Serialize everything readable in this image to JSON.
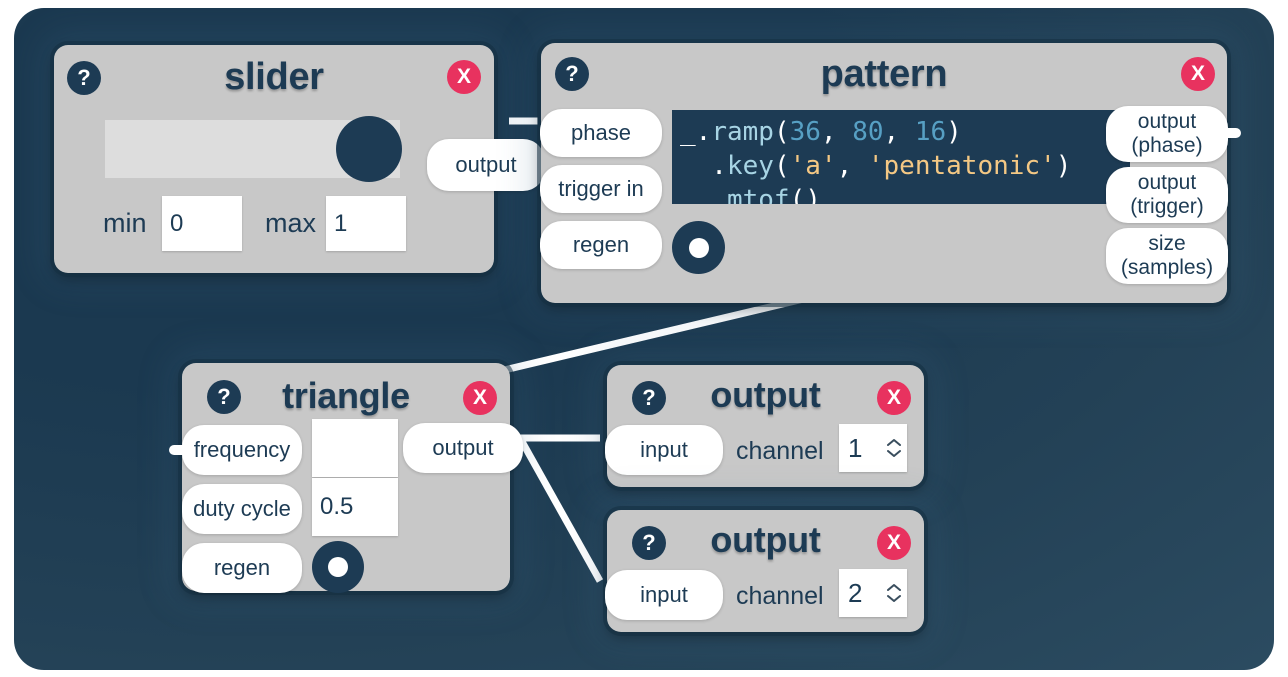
{
  "app": {
    "canvas_name": "node-graph-canvas",
    "background_color": "#1b3950",
    "node_color": "#c8c8c8",
    "accent_color": "#1d3b54",
    "close_color": "#e8325f",
    "wire_color": "#ffffff"
  },
  "icons": {
    "help": "?",
    "close": "X",
    "chevron_up": "▲",
    "chevron_down": "▼"
  },
  "nodes": {
    "slider": {
      "title": "slider",
      "help_label": "?",
      "close_label": "X",
      "slider_value_fraction": 0.87,
      "ports": {
        "output": "output"
      },
      "fields": {
        "min_label": "min",
        "min_value": "0",
        "max_label": "max",
        "max_value": "1"
      }
    },
    "pattern": {
      "title": "pattern",
      "help_label": "?",
      "close_label": "X",
      "inputs": {
        "phase": "phase",
        "trigger_in": "trigger in",
        "regen": "regen"
      },
      "outputs": {
        "output_phase_line1": "output",
        "output_phase_line2": "(phase)",
        "output_trigger_line1": "output",
        "output_trigger_line2": "(trigger)",
        "size_line1": "size",
        "size_line2": "(samples)"
      },
      "code": {
        "line1": [
          {
            "t": "_.",
            "c": "pun"
          },
          {
            "t": "ramp",
            "c": "fn"
          },
          {
            "t": "(",
            "c": "pun"
          },
          {
            "t": "36",
            "c": "num"
          },
          {
            "t": ", ",
            "c": "pun"
          },
          {
            "t": "80",
            "c": "num"
          },
          {
            "t": ", ",
            "c": "pun"
          },
          {
            "t": "16",
            "c": "num"
          },
          {
            "t": ")",
            "c": "pun"
          }
        ],
        "line2": [
          {
            "t": "  .",
            "c": "pun"
          },
          {
            "t": "key",
            "c": "fn"
          },
          {
            "t": "(",
            "c": "pun"
          },
          {
            "t": "'a'",
            "c": "str"
          },
          {
            "t": ", ",
            "c": "pun"
          },
          {
            "t": "'pentatonic'",
            "c": "str"
          },
          {
            "t": ")",
            "c": "pun"
          }
        ],
        "line3": [
          {
            "t": "  .",
            "c": "pun"
          },
          {
            "t": "mtof",
            "c": "fn"
          },
          {
            "t": "()",
            "c": "pun"
          }
        ]
      },
      "regen_toggle_state": "off"
    },
    "triangle": {
      "title": "triangle",
      "help_label": "?",
      "close_label": "X",
      "inputs": {
        "frequency": "frequency",
        "duty_cycle": "duty cycle",
        "regen": "regen"
      },
      "outputs": {
        "output": "output"
      },
      "fields": {
        "frequency_value": "",
        "duty_cycle_value": "0.5"
      },
      "regen_toggle_state": "off"
    },
    "output_1": {
      "title": "output",
      "help_label": "?",
      "close_label": "X",
      "input_port": "input",
      "channel_label": "channel",
      "channel_value": "1"
    },
    "output_2": {
      "title": "output",
      "help_label": "?",
      "close_label": "X",
      "input_port": "input",
      "channel_label": "channel",
      "channel_value": "2"
    }
  },
  "connections": [
    {
      "name": "slider-output-to-pattern-phase",
      "from": "slider.output",
      "to": "pattern.phase"
    },
    {
      "name": "pattern-to-triangle",
      "from": "pattern.bottom",
      "to": "triangle.top"
    },
    {
      "name": "triangle-output-to-output1-input",
      "from": "triangle.output",
      "to": "output_1.input"
    },
    {
      "name": "triangle-output-to-output2-input",
      "from": "triangle.output",
      "to": "output_2.input"
    }
  ]
}
